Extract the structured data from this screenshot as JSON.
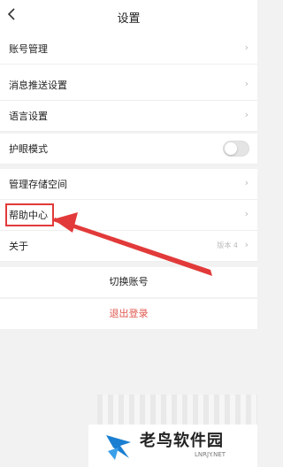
{
  "header": {
    "back_icon": "chevron-left-icon",
    "title": "设置"
  },
  "settings_group": {
    "items": [
      {
        "label": "账号管理",
        "type": "link"
      },
      {
        "label": "消息推送设置",
        "type": "link"
      },
      {
        "label": "语言设置",
        "type": "link"
      },
      {
        "label": "护眼模式",
        "type": "toggle",
        "on": false
      },
      {
        "label": "管理存储空间",
        "type": "link"
      },
      {
        "label": "帮助中心",
        "type": "link",
        "highlighted": true
      },
      {
        "label": "关于",
        "type": "link",
        "value": "版本 4"
      }
    ]
  },
  "actions": {
    "switch_account": "切换账号",
    "logout": "退出登录"
  },
  "colors": {
    "highlight": "#e23a3a",
    "logout": "#e0584f",
    "watermark_blue": "#1a7fd1"
  },
  "watermark": {
    "text": "老鸟软件园",
    "sub": "LNRJY.NET"
  }
}
